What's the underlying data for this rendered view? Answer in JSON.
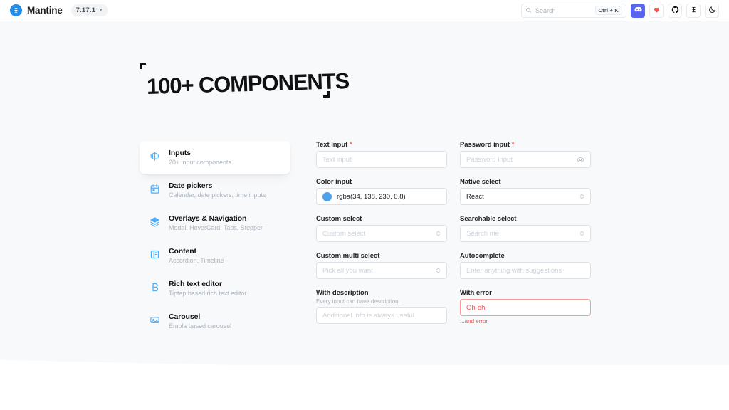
{
  "header": {
    "brand_name": "Mantine",
    "logo_icon": "mantine-logo-icon",
    "version": "7.17.1",
    "version_chevron_icon": "chevron-down-icon",
    "search": {
      "placeholder": "Search",
      "shortcut": "Ctrl + K",
      "icon": "search-icon"
    },
    "actions": [
      {
        "name": "discord-link",
        "icon": "discord-icon",
        "color": "#5865f2"
      },
      {
        "name": "sponsor-link",
        "icon": "heart-icon",
        "color": "#fa5252"
      },
      {
        "name": "github-link",
        "icon": "github-icon",
        "color": "#101113"
      },
      {
        "name": "mantine-logo-link",
        "icon": "mantine-mark-icon",
        "color": "#101113"
      },
      {
        "name": "theme-toggle",
        "icon": "moon-icon",
        "color": "#101113"
      }
    ]
  },
  "hero": {
    "title": "100+ COMPONENTS"
  },
  "nav": {
    "items": [
      {
        "title": "Inputs",
        "desc": "20+ input components",
        "icon": "form-input-icon",
        "active": true
      },
      {
        "title": "Date pickers",
        "desc": "Calendar, date pickers, time inputs",
        "icon": "calendar-icon",
        "active": false
      },
      {
        "title": "Overlays & Navigation",
        "desc": "Modal, HoverCard, Tabs, Stepper",
        "icon": "layers-icon",
        "active": false
      },
      {
        "title": "Content",
        "desc": "Accordion, Timeline",
        "icon": "layout-columns-icon",
        "active": false
      },
      {
        "title": "Rich text editor",
        "desc": "Tiptap based rich text editor",
        "icon": "bold-b-icon",
        "active": false
      },
      {
        "title": "Carousel",
        "desc": "Embla based carousel",
        "icon": "carousel-image-icon",
        "active": false
      }
    ]
  },
  "form": {
    "left": [
      {
        "id": "text-input",
        "label": "Text input",
        "required": true,
        "placeholder": "Text input",
        "value": "",
        "type": "text"
      },
      {
        "id": "color-input",
        "label": "Color input",
        "required": false,
        "placeholder": "",
        "value": "rgba(34, 138, 230, 0.8)",
        "swatch_color": "rgba(34, 138, 230, 0.8)",
        "type": "color"
      },
      {
        "id": "custom-select",
        "label": "Custom select",
        "required": false,
        "placeholder": "Custom select",
        "value": "",
        "type": "select"
      },
      {
        "id": "custom-multi-select",
        "label": "Custom multi select",
        "required": false,
        "placeholder": "Pick all you want",
        "value": "",
        "type": "select"
      },
      {
        "id": "with-description",
        "label": "With description",
        "required": false,
        "description": "Every input can have description...",
        "placeholder": "Additional info is always useful",
        "value": "",
        "type": "text"
      }
    ],
    "right": [
      {
        "id": "password-input",
        "label": "Password input",
        "required": true,
        "placeholder": "Password input",
        "value": "",
        "type": "password",
        "trailing_icon": "eye-icon"
      },
      {
        "id": "native-select",
        "label": "Native select",
        "required": false,
        "placeholder": "",
        "value": "React",
        "type": "select"
      },
      {
        "id": "searchable-select",
        "label": "Searchable select",
        "required": false,
        "placeholder": "Search me",
        "value": "",
        "type": "select"
      },
      {
        "id": "autocomplete",
        "label": "Autocomplete",
        "required": false,
        "placeholder": "Enter anything with suggestions",
        "value": "",
        "type": "text"
      },
      {
        "id": "with-error",
        "label": "With error",
        "required": false,
        "placeholder": "",
        "value": "Oh-oh",
        "error": "...and error",
        "type": "text"
      }
    ]
  },
  "colors": {
    "brand": "#228be6",
    "accent_icon": "#4dabf7",
    "error": "#fa5252",
    "hero_bg": "#f8f9fa",
    "border": "#dee2e6"
  }
}
